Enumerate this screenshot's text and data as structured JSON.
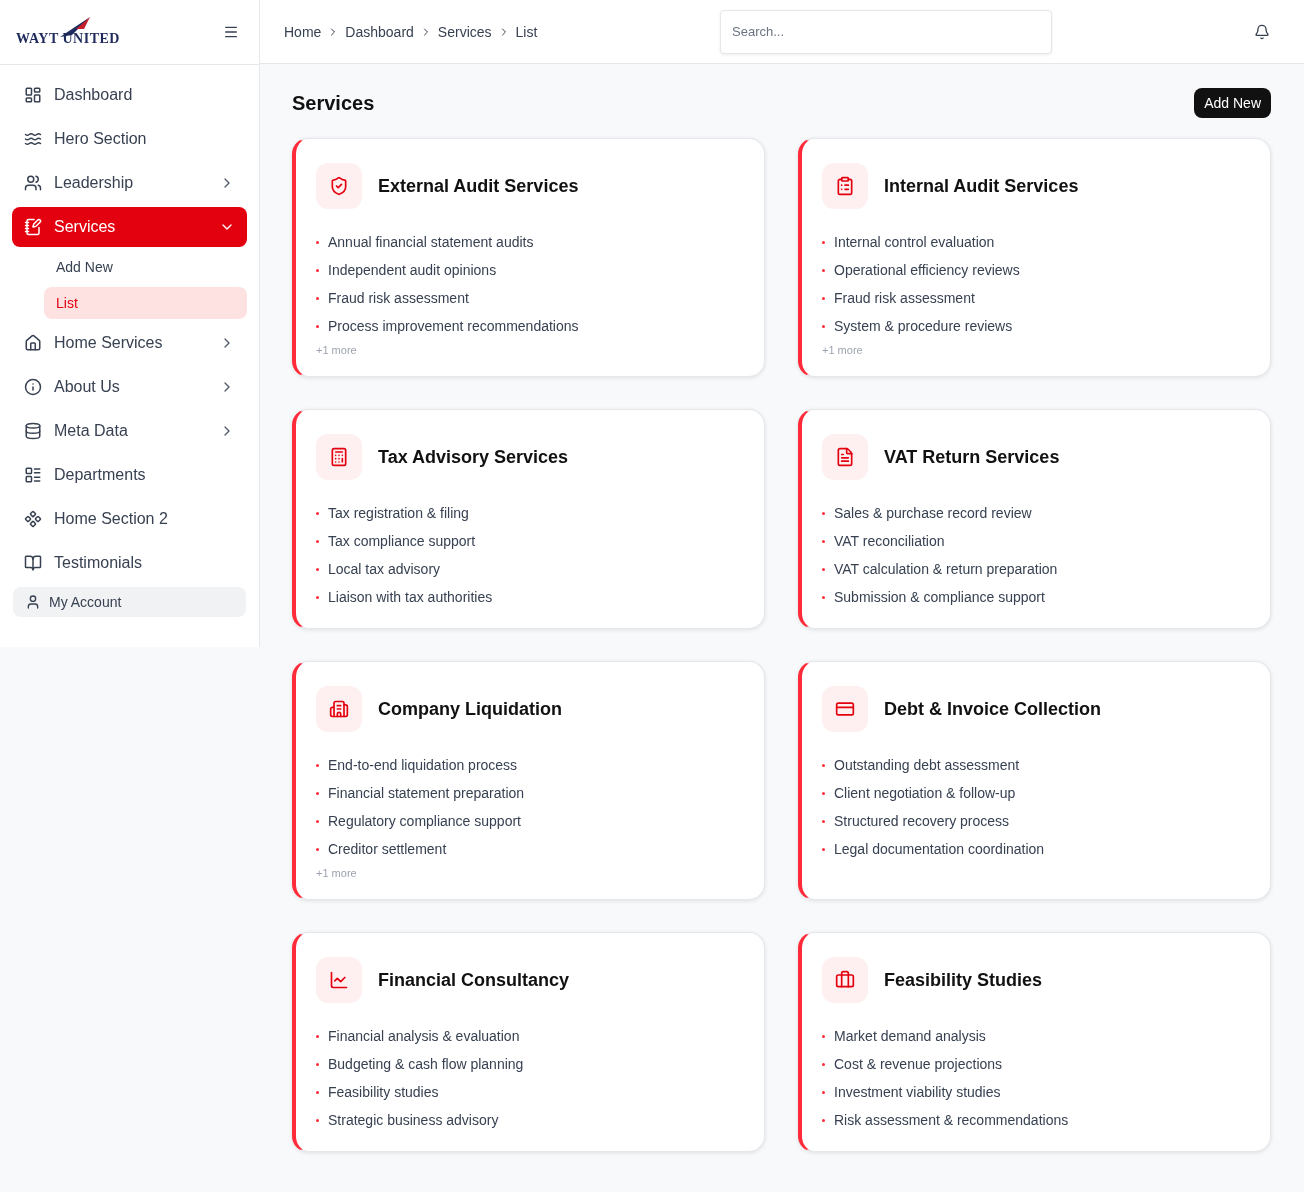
{
  "logo": {
    "text": "WAYT UNITED"
  },
  "sidebar": {
    "items": [
      {
        "label": "Dashboard",
        "selected": false
      },
      {
        "label": "Hero Section",
        "selected": false
      },
      {
        "label": "Leadership",
        "expanded": false,
        "selected": false
      },
      {
        "label": "Services",
        "expanded": true,
        "selected": true,
        "children": [
          {
            "label": "Add New",
            "selected": false
          },
          {
            "label": "List",
            "selected": true
          }
        ]
      },
      {
        "label": "Home Services",
        "expanded": false,
        "selected": false
      },
      {
        "label": "About Us",
        "expanded": false,
        "selected": false
      },
      {
        "label": "Meta Data",
        "expanded": false,
        "selected": false
      },
      {
        "label": "Departments",
        "selected": false
      },
      {
        "label": "Home Section 2",
        "selected": false
      },
      {
        "label": "Testimonials",
        "selected": false
      }
    ],
    "account": "My Account"
  },
  "breadcrumb": [
    "Home",
    "Dashboard",
    "Services",
    "List"
  ],
  "search": {
    "placeholder": "Search..."
  },
  "page": {
    "title": "Services",
    "add_button": "Add New"
  },
  "cards": [
    {
      "title": "External Audit Services",
      "points": [
        "Annual financial statement audits",
        "Independent audit opinions",
        "Fraud risk assessment",
        "Process improvement recommendations"
      ],
      "more": "+1 more"
    },
    {
      "title": "Internal Audit Services",
      "points": [
        "Internal control evaluation",
        "Operational efficiency reviews",
        "Fraud risk assessment",
        "System & procedure reviews"
      ],
      "more": "+1 more"
    },
    {
      "title": "Tax Advisory Services",
      "points": [
        "Tax registration & filing",
        "Tax compliance support",
        "Local tax advisory",
        "Liaison with tax authorities"
      ]
    },
    {
      "title": "VAT Return Services",
      "points": [
        "Sales & purchase record review",
        "VAT reconciliation",
        "VAT calculation & return preparation",
        "Submission & compliance support"
      ]
    },
    {
      "title": "Company Liquidation",
      "points": [
        "End-to-end liquidation process",
        "Financial statement preparation",
        "Regulatory compliance support",
        "Creditor settlement"
      ],
      "more": "+1 more"
    },
    {
      "title": "Debt & Invoice Collection",
      "points": [
        "Outstanding debt assessment",
        "Client negotiation & follow-up",
        "Structured recovery process",
        "Legal documentation coordination"
      ]
    },
    {
      "title": "Financial Consultancy",
      "points": [
        "Financial analysis & evaluation",
        "Budgeting & cash flow planning",
        "Feasibility studies",
        "Strategic business advisory"
      ]
    },
    {
      "title": "Feasibility Studies",
      "points": [
        "Market demand analysis",
        "Cost & revenue projections",
        "Investment viability studies",
        "Risk assessment & recommendations"
      ]
    }
  ]
}
